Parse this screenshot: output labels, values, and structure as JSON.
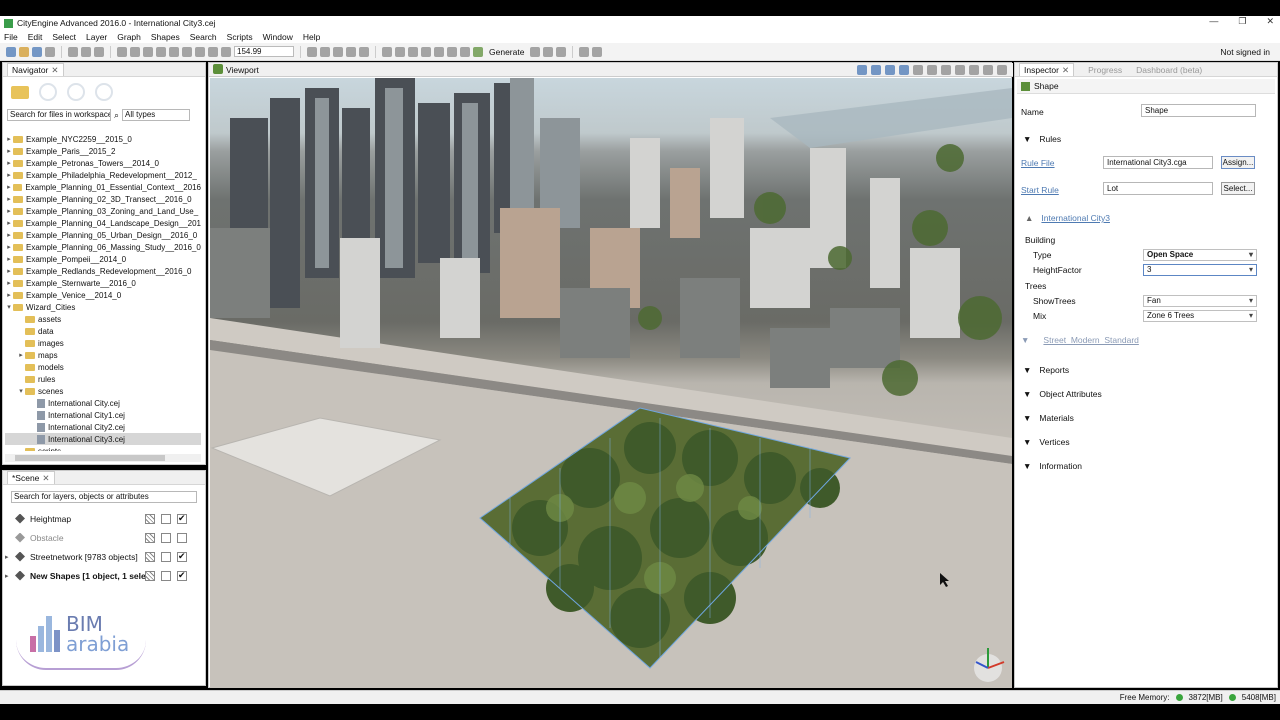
{
  "window": {
    "title": "CityEngine Advanced 2016.0 - International City3.cej",
    "controls": [
      "—",
      "❐",
      "✕"
    ]
  },
  "menu": [
    "File",
    "Edit",
    "Select",
    "Layer",
    "Graph",
    "Shapes",
    "Search",
    "Scripts",
    "Window",
    "Help"
  ],
  "toolbar": {
    "zoom_value": "154.99",
    "generate_label": "Generate",
    "signed_in": "Not signed in"
  },
  "navigator": {
    "tab": "Navigator",
    "search_placeholder": "Search for files in workspace",
    "type_filter": "All types",
    "tree": [
      {
        "label": "Example_NYC2259__2015_0",
        "depth": 0,
        "kind": "folder",
        "twisty": "▸"
      },
      {
        "label": "Example_Paris__2015_2",
        "depth": 0,
        "kind": "folder",
        "twisty": "▸"
      },
      {
        "label": "Example_Petronas_Towers__2014_0",
        "depth": 0,
        "kind": "folder",
        "twisty": "▸"
      },
      {
        "label": "Example_Philadelphia_Redevelopment__2012_",
        "depth": 0,
        "kind": "folder",
        "twisty": "▸"
      },
      {
        "label": "Example_Planning_01_Essential_Context__2016",
        "depth": 0,
        "kind": "folder",
        "twisty": "▸"
      },
      {
        "label": "Example_Planning_02_3D_Transect__2016_0",
        "depth": 0,
        "kind": "folder",
        "twisty": "▸"
      },
      {
        "label": "Example_Planning_03_Zoning_and_Land_Use_",
        "depth": 0,
        "kind": "folder",
        "twisty": "▸"
      },
      {
        "label": "Example_Planning_04_Landscape_Design__201",
        "depth": 0,
        "kind": "folder",
        "twisty": "▸"
      },
      {
        "label": "Example_Planning_05_Urban_Design__2016_0",
        "depth": 0,
        "kind": "folder",
        "twisty": "▸"
      },
      {
        "label": "Example_Planning_06_Massing_Study__2016_0",
        "depth": 0,
        "kind": "folder",
        "twisty": "▸"
      },
      {
        "label": "Example_Pompeii__2014_0",
        "depth": 0,
        "kind": "folder",
        "twisty": "▸"
      },
      {
        "label": "Example_Redlands_Redevelopment__2016_0",
        "depth": 0,
        "kind": "folder",
        "twisty": "▸"
      },
      {
        "label": "Example_Sternwarte__2016_0",
        "depth": 0,
        "kind": "folder",
        "twisty": "▸"
      },
      {
        "label": "Example_Venice__2014_0",
        "depth": 0,
        "kind": "folder",
        "twisty": "▸"
      },
      {
        "label": "Wizard_Cities",
        "depth": 0,
        "kind": "folder",
        "twisty": "▾"
      },
      {
        "label": "assets",
        "depth": 1,
        "kind": "folder",
        "twisty": ""
      },
      {
        "label": "data",
        "depth": 1,
        "kind": "folder",
        "twisty": ""
      },
      {
        "label": "images",
        "depth": 1,
        "kind": "folder",
        "twisty": ""
      },
      {
        "label": "maps",
        "depth": 1,
        "kind": "folder",
        "twisty": "▸"
      },
      {
        "label": "models",
        "depth": 1,
        "kind": "folder",
        "twisty": ""
      },
      {
        "label": "rules",
        "depth": 1,
        "kind": "folder",
        "twisty": ""
      },
      {
        "label": "scenes",
        "depth": 1,
        "kind": "folder",
        "twisty": "▾"
      },
      {
        "label": "International City.cej",
        "depth": 2,
        "kind": "file",
        "twisty": ""
      },
      {
        "label": "International City1.cej",
        "depth": 2,
        "kind": "file",
        "twisty": ""
      },
      {
        "label": "International City2.cej",
        "depth": 2,
        "kind": "file",
        "twisty": ""
      },
      {
        "label": "International City3.cej",
        "depth": 2,
        "kind": "file",
        "twisty": "",
        "selected": true
      },
      {
        "label": "scripts",
        "depth": 1,
        "kind": "folder",
        "twisty": ""
      }
    ]
  },
  "scene": {
    "tab": "*Scene",
    "search_placeholder": "Search for layers, objects or attributes",
    "layers": [
      {
        "label": "Heightmap",
        "bold": false,
        "grey": false,
        "checks": [
          "hatch",
          "empty",
          "on"
        ]
      },
      {
        "label": "Obstacle",
        "bold": false,
        "grey": true,
        "checks": [
          "hatch",
          "empty",
          "empty"
        ]
      },
      {
        "label": "Streetnetwork [9783 objects]",
        "bold": false,
        "grey": false,
        "twisty": "▸",
        "checks": [
          "hatch",
          "empty",
          "on"
        ]
      },
      {
        "label": "New Shapes [1 object, 1 selecte",
        "bold": true,
        "grey": false,
        "twisty": "▸",
        "checks": [
          "hatch",
          "empty",
          "on"
        ]
      }
    ]
  },
  "logo": {
    "line1": "BIM",
    "line2": "arabia"
  },
  "viewport": {
    "tab": "Viewport"
  },
  "inspector": {
    "tabs": [
      "Inspector",
      "Progress",
      "Dashboard (beta)"
    ],
    "header": "Shape",
    "name_label": "Name",
    "name_value": "Shape",
    "rules_header": "Rules",
    "rule_file_label": "Rule File",
    "rule_file_value": "International City3.cga",
    "assign_btn": "Assign...",
    "start_rule_label": "Start Rule",
    "start_rule_value": "Lot",
    "select_btn": "Select...",
    "rule_group": "International City3",
    "building_label": "Building",
    "type_label": "Type",
    "type_value": "Open Space",
    "height_label": "HeightFactor",
    "height_value": "3",
    "trees_label": "Trees",
    "showtrees_label": "ShowTrees",
    "showtrees_value": "Fan",
    "mix_label": "Mix",
    "mix_value": "Zone 6 Trees",
    "street_link": "Street_Modern_Standard",
    "sections": [
      "Reports",
      "Object Attributes",
      "Materials",
      "Vertices",
      "Information"
    ]
  },
  "status": {
    "free_memory_label": "Free Memory:",
    "mem1": "3872[MB]",
    "mem2": "5408[MB]"
  }
}
